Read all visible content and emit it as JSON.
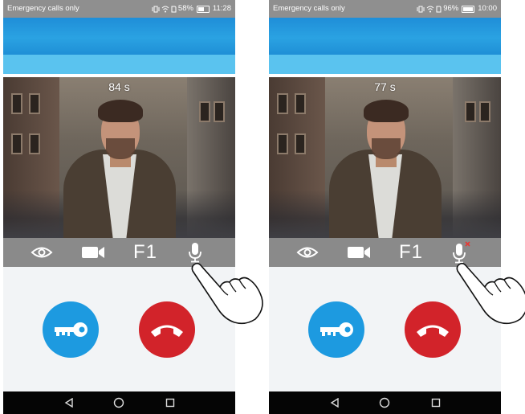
{
  "screens": [
    {
      "status": {
        "left_text": "Emergency calls only",
        "battery": "58%",
        "time": "11:28",
        "battery_level": 0.58
      },
      "timer": "84 s",
      "toolbar": {
        "monitor_icon": "eye-icon",
        "camera_icon": "video-camera-icon",
        "f1_label": "F1",
        "mic_icon": "microphone-icon",
        "mic_muted": false
      },
      "actions": {
        "unlock_icon": "key-icon",
        "hangup_icon": "phone-hangup-icon"
      },
      "nav": {
        "back_icon": "back-triangle-icon",
        "home_icon": "home-circle-icon",
        "recents_icon": "recents-square-icon"
      }
    },
    {
      "status": {
        "left_text": "Emergency calls only",
        "battery": "96%",
        "time": "10:00",
        "battery_level": 0.96
      },
      "timer": "77 s",
      "toolbar": {
        "monitor_icon": "eye-icon",
        "camera_icon": "video-camera-icon",
        "f1_label": "F1",
        "mic_icon": "microphone-icon",
        "mic_muted": true
      },
      "actions": {
        "unlock_icon": "key-icon",
        "hangup_icon": "phone-hangup-icon"
      },
      "nav": {
        "back_icon": "back-triangle-icon",
        "home_icon": "home-circle-icon",
        "recents_icon": "recents-square-icon"
      }
    }
  ],
  "colors": {
    "header": "#2aa2e2",
    "subbar": "#5ac3ef",
    "toolbar": "#8a8a8a",
    "unlock": "#1d9ae0",
    "hangup": "#d2232a",
    "mute_mark": "#e53935"
  }
}
